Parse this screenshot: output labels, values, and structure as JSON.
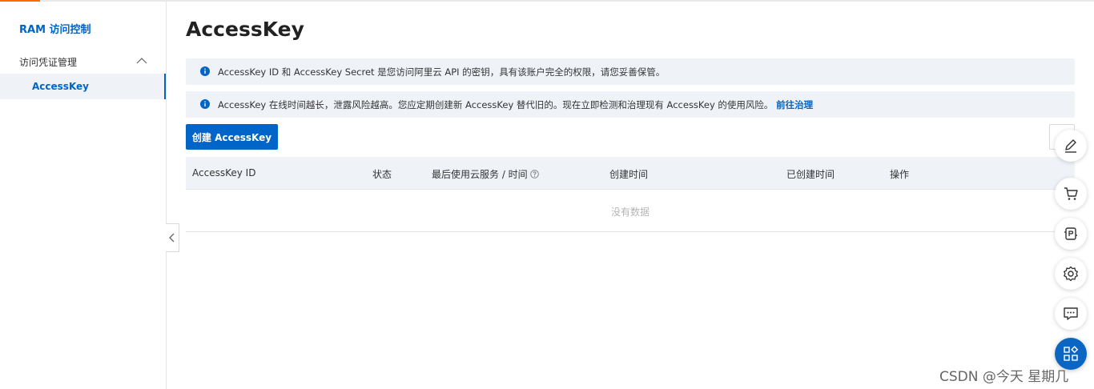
{
  "sidebar": {
    "brand": "RAM 访问控制",
    "group_label": "访问凭证管理",
    "active_item": "AccessKey"
  },
  "page": {
    "title": "AccessKey"
  },
  "alerts": {
    "first": "AccessKey ID 和 AccessKey Secret 是您访问阿里云 API 的密钥，具有该账户完全的权限，请您妥善保管。",
    "second": "AccessKey 在线时间越长，泄露风险越高。您应定期创建新 AccessKey 替代旧的。现在立即检测和治理现有 AccessKey 的使用风险。",
    "second_link": "前往治理"
  },
  "toolbar": {
    "create_label": "创建 AccessKey"
  },
  "table": {
    "columns": [
      "AccessKey ID",
      "状态",
      "最后使用云服务 / 时间",
      "创建时间",
      "已创建时间",
      "操作"
    ],
    "empty_text": "没有数据"
  },
  "floating_tools": [
    "edit-icon",
    "cart-icon",
    "api-icon",
    "settings-icon",
    "feedback-icon",
    "apps-icon"
  ],
  "watermark": "CSDN @今天 星期几",
  "colors": {
    "primary": "#0064c8",
    "accent": "#ff6a00",
    "panel_bg": "#eff3f8"
  }
}
